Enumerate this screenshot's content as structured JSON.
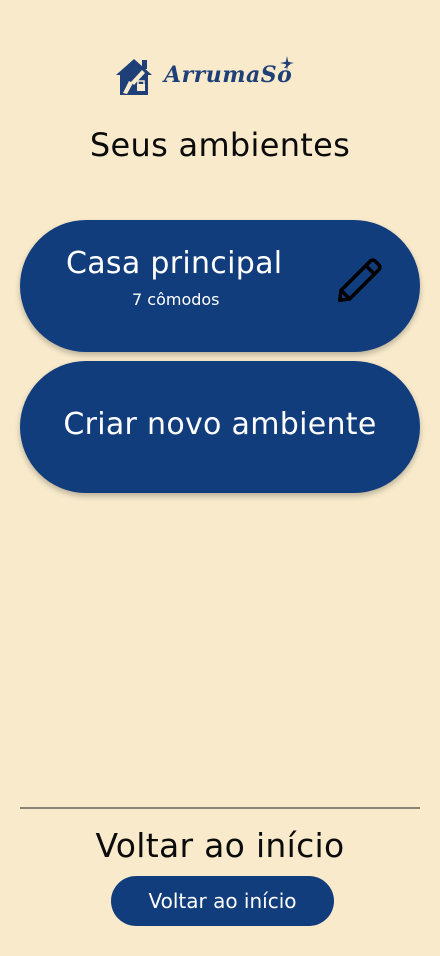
{
  "brand": {
    "name": "ArrumaSó",
    "color": "#1f3f78",
    "icon": "house-cleaning-logo-icon"
  },
  "page_title": "Seus ambientes",
  "environments": [
    {
      "name": "Casa principal",
      "count_label": "7 cômodos",
      "action_icon": "pencil-edit-icon"
    }
  ],
  "create_button": {
    "label": "Criar novo ambiente"
  },
  "footer": {
    "title": "Voltar ao início",
    "button_label": "Voltar ao início"
  },
  "colors": {
    "background": "#f8eacb",
    "primary": "#123d7d",
    "text": "#0b0b0b",
    "on_primary": "#ffffff",
    "divider": "#8a8377"
  }
}
